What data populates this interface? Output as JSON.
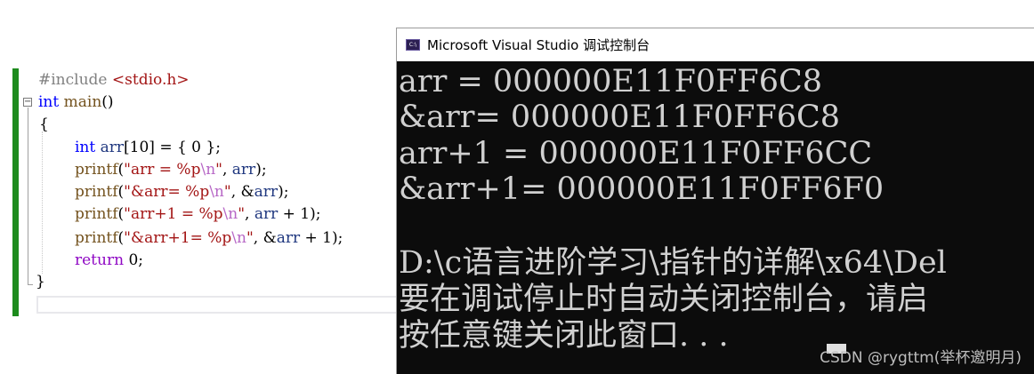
{
  "editor": {
    "lines": {
      "l1": {
        "pp": "#include",
        "hdr": "<stdio.h>"
      },
      "l2": {
        "kw": "int",
        "fn": "main",
        "rest": "()"
      },
      "l3": {
        "brace": "{"
      },
      "l4": {
        "kw": "int",
        "var": "arr",
        "rest": "[10] = { 0 };"
      },
      "l5": {
        "fn": "printf",
        "open": "(",
        "s1": "\"arr = %p",
        "esc": "\\n",
        "s2": "\"",
        "args": ", ",
        "var": "arr",
        "close": ");"
      },
      "l6": {
        "fn": "printf",
        "open": "(",
        "s1": "\"&arr= %p",
        "esc": "\\n",
        "s2": "\"",
        "args": ", &",
        "var": "arr",
        "close": ");"
      },
      "l7": {
        "fn": "printf",
        "open": "(",
        "s1": "\"arr+1 = %p",
        "esc": "\\n",
        "s2": "\"",
        "args": ", ",
        "var": "arr",
        "close": " + 1);"
      },
      "l8": {
        "fn": "printf",
        "open": "(",
        "s1": "\"&arr+1= %p",
        "esc": "\\n",
        "s2": "\"",
        "args": ", &",
        "var": "arr",
        "close": " + 1);"
      },
      "l9": {
        "kw": "return",
        "rest": " 0;"
      },
      "l10": {
        "brace": "}"
      }
    },
    "collapse_glyph": "−"
  },
  "console": {
    "title": "Microsoft Visual Studio 调试控制台",
    "icon_label": "C:\\",
    "icon_name": "console-app-icon",
    "output": [
      "arr = 000000E11F0FF6C8",
      "&arr= 000000E11F0FF6C8",
      "arr+1 = 000000E11F0FF6CC",
      "&arr+1= 000000E11F0FF6F0",
      "",
      "D:\\c语言进阶学习\\指针的详解\\x64\\Del",
      "要在调试停止时自动关闭控制台，请启",
      "按任意键关闭此窗口. . ."
    ]
  },
  "watermark": "CSDN @rygttm(举杯邀明月)",
  "colors": {
    "keyword": "#0000ff",
    "string": "#a31515",
    "escape": "#b767c6",
    "function": "#74531f",
    "variable": "#1f377f",
    "console_bg": "#0c0c0c",
    "console_text": "#d0d0d0",
    "change_bar": "#1d8b1d"
  }
}
